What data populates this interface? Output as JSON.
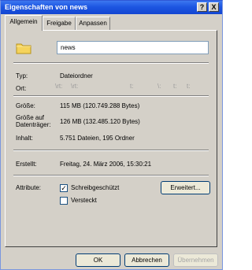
{
  "window": {
    "title": "Eigenschaften von news",
    "help_label": "?",
    "close_label": "X"
  },
  "tabs": [
    {
      "label": "Allgemein",
      "active": true
    },
    {
      "label": "Freigabe",
      "active": false
    },
    {
      "label": "Anpassen",
      "active": false
    }
  ],
  "general": {
    "folder_name": "news",
    "type_label": "Typ:",
    "type_value": "Dateiordner",
    "location_label": "Ort:",
    "location_fragments": [
      "\\rt:",
      "\\rt:",
      "t:",
      "\\:",
      "t:",
      "t:"
    ],
    "size_label": "Größe:",
    "size_value": "115 MB (120.749.288 Bytes)",
    "disk_size_label_line1": "Größe auf",
    "disk_size_label_line2": "Datenträger:",
    "disk_size_value": "126 MB (132.485.120 Bytes)",
    "contents_label": "Inhalt:",
    "contents_value": "5.751 Dateien, 195 Ordner",
    "created_label": "Erstellt:",
    "created_value": "Freitag, 24. März 2006, 15:30:21",
    "attributes_label": "Attribute:",
    "readonly_label": "Schreibgeschützt",
    "readonly_checked": true,
    "hidden_label": "Versteckt",
    "hidden_checked": false,
    "check_mark": "✓",
    "advanced_button": "Erweitert..."
  },
  "footer": {
    "ok": "OK",
    "cancel": "Abbrechen",
    "apply": "Übernehmen"
  },
  "colors": {
    "titlebar": "#1d56e2",
    "window_bg": "#d4d0c8",
    "folder": "#f5d35c"
  }
}
